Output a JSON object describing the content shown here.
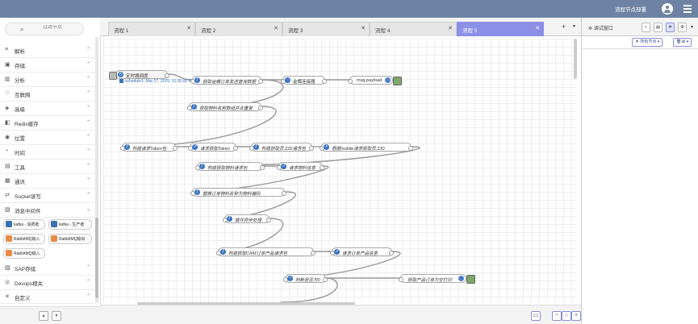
{
  "header": {
    "deploy_label": "流程节点部署"
  },
  "palette": {
    "search_placeholder": "过滤节点",
    "categories": [
      {
        "label": "解析",
        "icon": "≡"
      },
      {
        "label": "存储",
        "icon": "▣"
      },
      {
        "label": "分析",
        "icon": "▥"
      },
      {
        "label": "互联网",
        "icon": "♡"
      },
      {
        "label": "高级",
        "icon": "◈"
      },
      {
        "label": "Redis缓存",
        "icon": "◧"
      },
      {
        "label": "位置",
        "icon": "◉"
      },
      {
        "label": "时间",
        "icon": "◔"
      },
      {
        "label": "工具",
        "icon": "▤"
      },
      {
        "label": "通讯",
        "icon": "▦"
      },
      {
        "label": "Socket读写",
        "icon": "⇄"
      },
      {
        "label": "消息中间件",
        "icon": "▧"
      },
      {
        "label": "SAP存储",
        "icon": "▨"
      },
      {
        "label": "Devops相关",
        "icon": "◎"
      },
      {
        "label": "自定义",
        "icon": "✕"
      }
    ],
    "mq_nodes": [
      "kafka - 消费者",
      "kafka - 生产者",
      "RabbitMQ输入",
      "RabbitMQ输出",
      "RabbitMQ输入"
    ]
  },
  "tabs": [
    {
      "label": "流程 1"
    },
    {
      "label": "流程 2"
    },
    {
      "label": "流程 3"
    },
    {
      "label": "流程 4"
    },
    {
      "label": "流程 5"
    }
  ],
  "flow": {
    "status_text": "schedule1: Mar 27, 2025, 01:30:00 PM",
    "nodes": [
      "定时器调度",
      "获取金蝶订单发送查询数据",
      "金蝶连接器",
      "msg.payload",
      "获取物料名称数组并去重复",
      "构建请求Token包",
      "请求获取Token",
      "构建获取员工ID请求包",
      "根据mobile请求获取员工ID",
      "构建获取物料请求包",
      "请求物料信息",
      "替换订单物料名称为物料编码",
      "循环异步处理",
      "构建获取CRM订单产品请求包",
      "请求订单产品信息",
      "判断是否为0",
      "获取产品订单为空打印"
    ]
  },
  "sidebar": {
    "title": "调试窗口",
    "filter_nodes": "所有节点",
    "filter_all": "all"
  }
}
